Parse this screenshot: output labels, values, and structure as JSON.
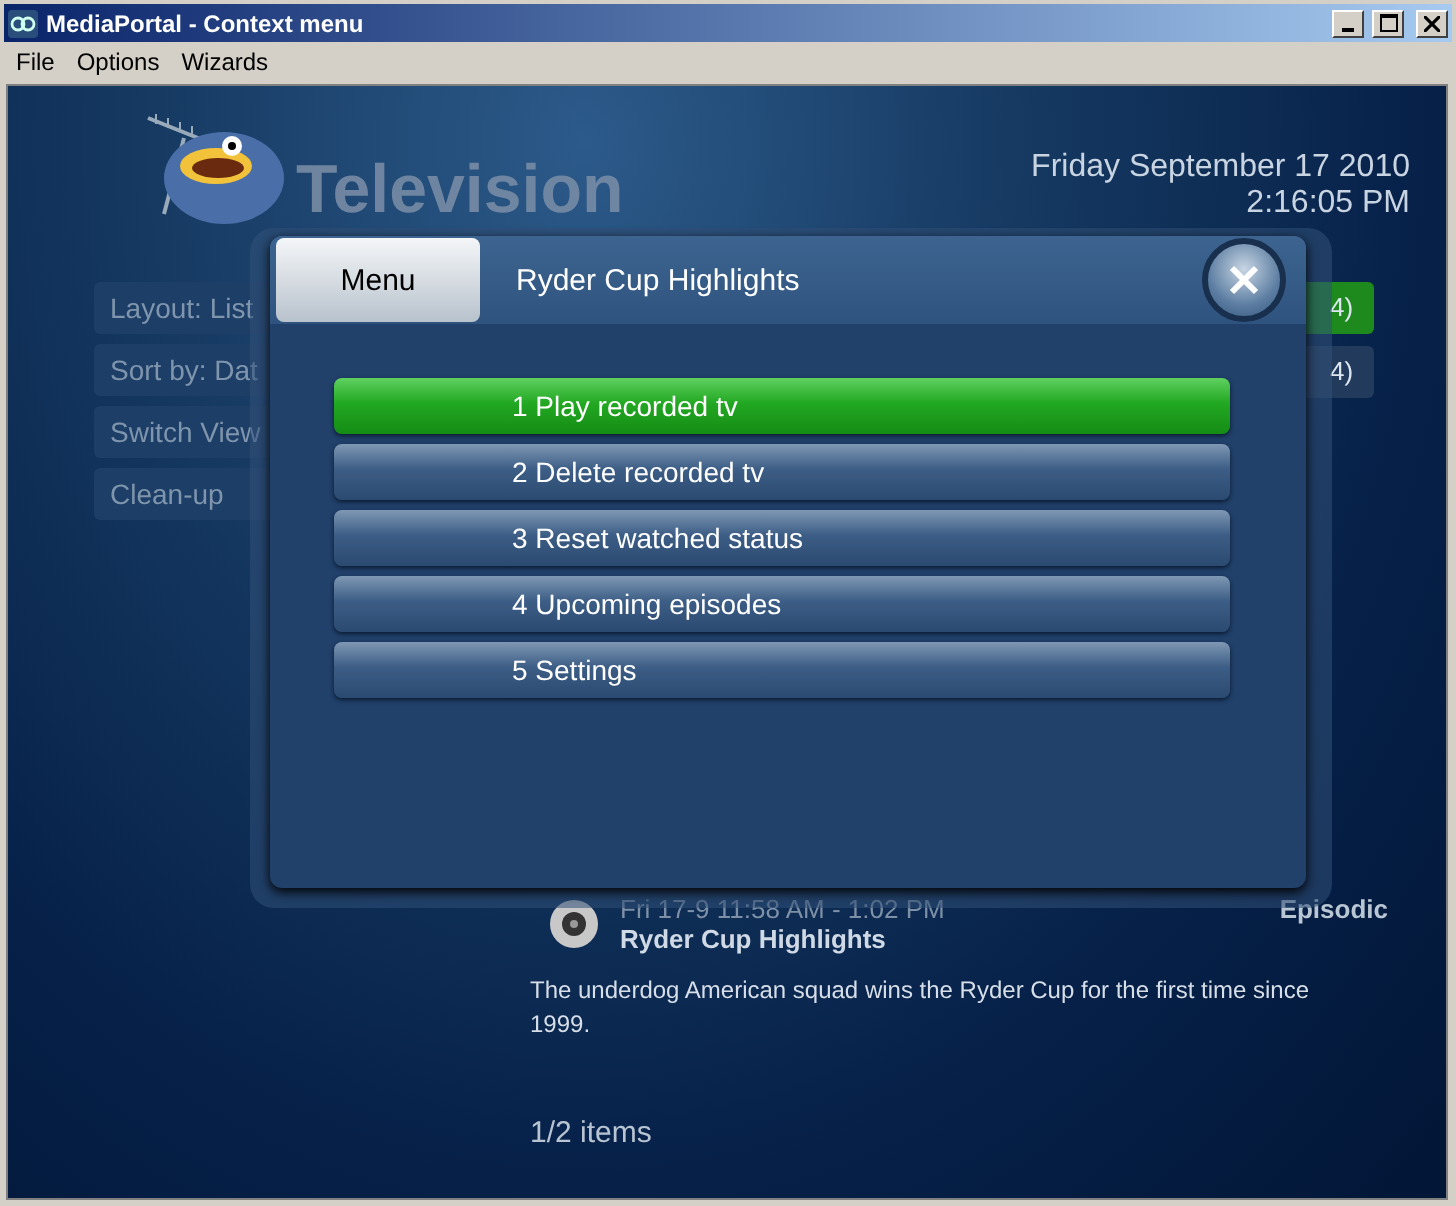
{
  "window": {
    "title": "MediaPortal - Context menu"
  },
  "menu_bar": [
    {
      "label": "File"
    },
    {
      "label": "Options"
    },
    {
      "label": "Wizards"
    }
  ],
  "header": {
    "title": "Television",
    "date": "Friday September 17 2010",
    "time": "2:16:05 PM"
  },
  "side_buttons": [
    "Layout: List",
    "Sort by: Dat",
    "Switch View",
    "Clean-up"
  ],
  "list_items": [
    {
      "text": "4)",
      "selected": true
    },
    {
      "text": "4)",
      "selected": false
    }
  ],
  "recording": {
    "time": "Fri 17-9 11:58 AM - 1:02 PM",
    "title": "Ryder Cup Highlights",
    "genre": "Episodic",
    "description": "The underdog American squad wins the Ryder Cup for the first time since 1999."
  },
  "item_count": "1/2 items",
  "dialog": {
    "tab": "Menu",
    "title": "Ryder Cup Highlights",
    "items": [
      {
        "label": "1 Play recorded tv",
        "selected": true
      },
      {
        "label": "2 Delete recorded tv",
        "selected": false
      },
      {
        "label": "3 Reset watched status",
        "selected": false
      },
      {
        "label": "4 Upcoming episodes",
        "selected": false
      },
      {
        "label": "5 Settings",
        "selected": false
      }
    ]
  }
}
